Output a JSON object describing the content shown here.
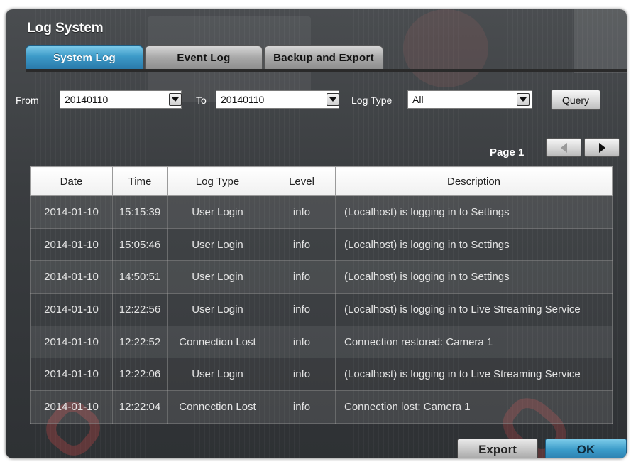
{
  "window": {
    "title": "Log System"
  },
  "tabs": [
    {
      "label": "System Log",
      "active": true
    },
    {
      "label": "Event Log",
      "active": false
    },
    {
      "label": "Backup and Export",
      "active": false
    }
  ],
  "filters": {
    "from_label": "From",
    "from_value": "20140110",
    "to_label": "To",
    "to_value": "20140110",
    "log_type_label": "Log Type",
    "log_type_value": "All",
    "query_label": "Query"
  },
  "pagination": {
    "page_label": "Page 1"
  },
  "table": {
    "headers": [
      "Date",
      "Time",
      "Log Type",
      "Level",
      "Description"
    ],
    "rows": [
      [
        "2014-01-10",
        "15:15:39",
        "User Login",
        "info",
        "(Localhost) is logging in to Settings"
      ],
      [
        "2014-01-10",
        "15:05:46",
        "User Login",
        "info",
        "(Localhost) is logging in to Settings"
      ],
      [
        "2014-01-10",
        "14:50:51",
        "User Login",
        "info",
        "(Localhost) is logging in to Settings"
      ],
      [
        "2014-01-10",
        "12:22:56",
        "User Login",
        "info",
        "(Localhost) is logging in to Live Streaming Service"
      ],
      [
        "2014-01-10",
        "12:22:52",
        "Connection Lost",
        "info",
        "Connection restored: Camera 1"
      ],
      [
        "2014-01-10",
        "12:22:06",
        "User Login",
        "info",
        "(Localhost) is logging in to Live Streaming Service"
      ],
      [
        "2014-01-10",
        "12:22:04",
        "Connection Lost",
        "info",
        "Connection lost: Camera 1"
      ]
    ]
  },
  "footer": {
    "export_label": "Export",
    "ok_label": "OK"
  },
  "colors": {
    "accent": "#3c9ac8",
    "panel": "#3a3d40"
  },
  "icons": {
    "dropdown": "chevron-down-icon",
    "prev": "arrow-left-icon",
    "next": "arrow-right-icon"
  }
}
